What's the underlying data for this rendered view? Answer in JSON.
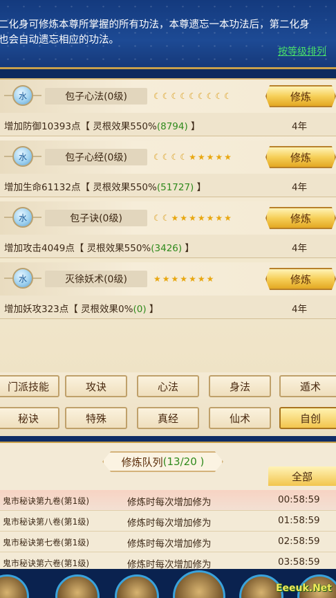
{
  "info": {
    "line1": "二化身可修炼本尊所掌握的所有功法，本尊遗忘一本功法后，第二化身",
    "line2": "也会自动遗忘相应的功法。",
    "sort_link": "按等级排列"
  },
  "skills": [
    {
      "element": "水",
      "name": "包子心法(0级)",
      "moons": 9,
      "stars": 0,
      "train": "修炼",
      "effect_pre": "增加防御10393点【 灵根效果550%",
      "effect_val": "(8794)",
      "effect_post": " 】",
      "time": "4年"
    },
    {
      "element": "水",
      "name": "包子心经(0级)",
      "moons": 4,
      "stars": 5,
      "train": "修炼",
      "effect_pre": "增加生命61132点【 灵根效果550%",
      "effect_val": "(51727)",
      "effect_post": " 】",
      "time": "4年"
    },
    {
      "element": "水",
      "name": "包子诀(0级)",
      "moons": 2,
      "stars": 7,
      "train": "修炼",
      "effect_pre": "增加攻击4049点【 灵根效果550%",
      "effect_val": "(3426)",
      "effect_post": " 】",
      "time": "4年"
    },
    {
      "element": "水",
      "name": "灭徐妖术(0级)",
      "moons": 0,
      "stars": 7,
      "train": "修炼",
      "effect_pre": "增加妖攻323点【 灵根效果0%",
      "effect_val": "(0)",
      "effect_post": " 】",
      "time": "4年"
    }
  ],
  "categories": [
    "门派技能",
    "攻诀",
    "心法",
    "身法",
    "遁术",
    "秘诀",
    "特殊",
    "真经",
    "仙术",
    "自创"
  ],
  "active_category": "自创",
  "queue": {
    "title": "修炼队列",
    "count": "(13/20 )",
    "all_button": "全部",
    "rows": [
      {
        "skill": "鬼市秘诀第九卷(第1级)",
        "desc": "修炼时每次增加修为",
        "time": "00:58:59"
      },
      {
        "skill": "鬼市秘诀第八卷(第1级)",
        "desc": "修炼时每次增加修为",
        "time": "01:58:59"
      },
      {
        "skill": "鬼市秘诀第七卷(第1级)",
        "desc": "修炼时每次增加修为",
        "time": "02:58:59"
      },
      {
        "skill": "鬼市秘诀第六卷(第1级)",
        "desc": "修炼时每次增加修为",
        "time": "03:58:59"
      }
    ]
  },
  "watermark": "Eeeuk.Net"
}
